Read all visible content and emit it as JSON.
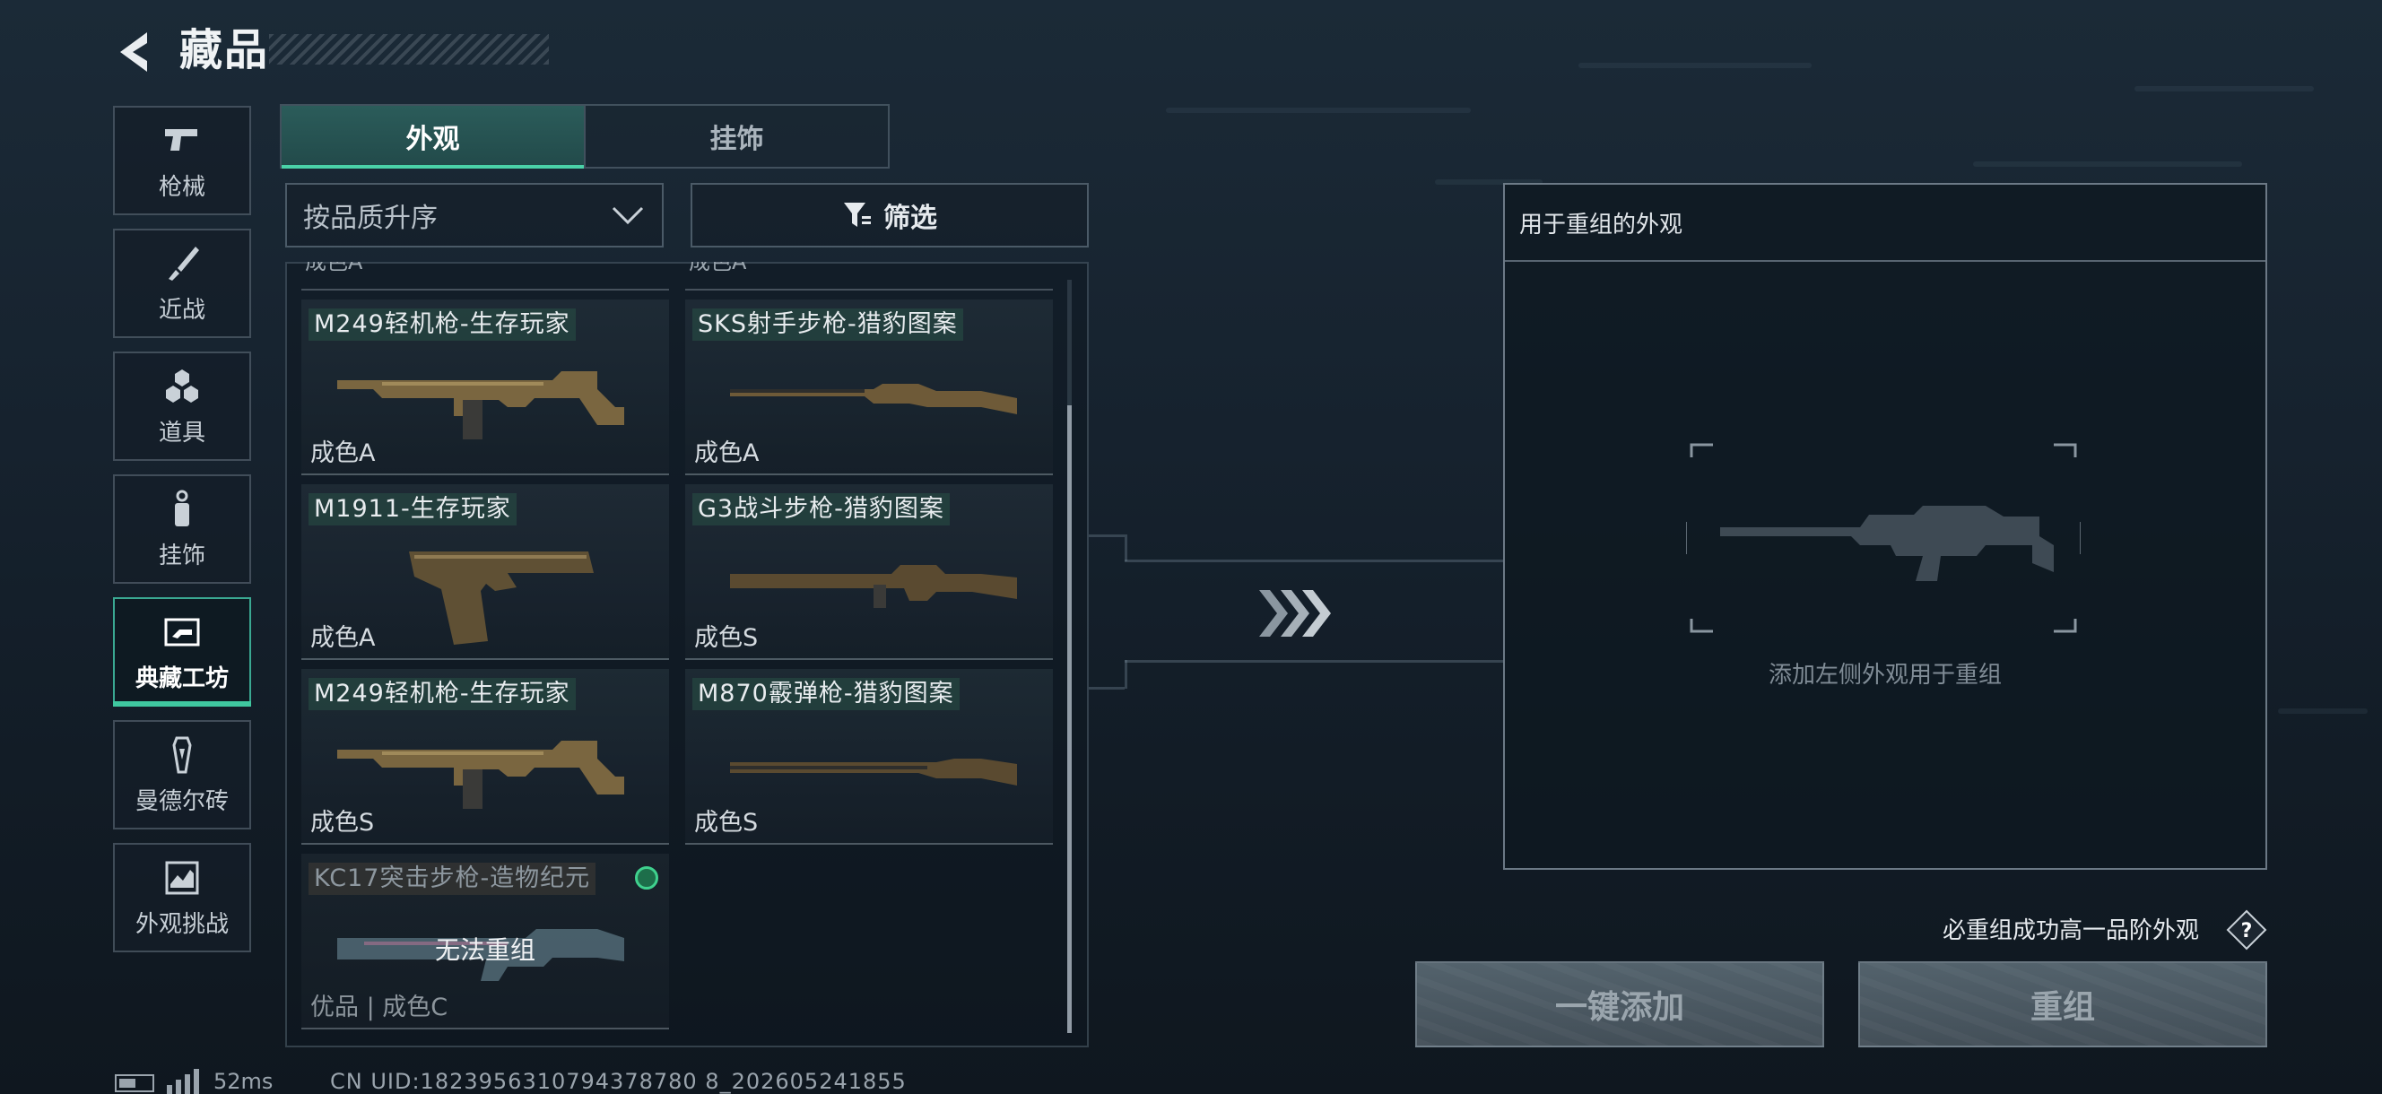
{
  "header": {
    "title": "藏品"
  },
  "sidebar": {
    "items": [
      {
        "label": "枪械",
        "icon": "pistol-icon"
      },
      {
        "label": "近战",
        "icon": "knife-icon"
      },
      {
        "label": "道具",
        "icon": "hexagon-cluster-icon"
      },
      {
        "label": "挂饰",
        "icon": "charm-icon"
      },
      {
        "label": "典藏工坊",
        "icon": "workshop-icon",
        "active": true
      },
      {
        "label": "曼德尔砖",
        "icon": "mandel-brick-icon"
      },
      {
        "label": "外观挑战",
        "icon": "challenge-icon"
      }
    ]
  },
  "tabs": [
    {
      "label": "外观",
      "active": true
    },
    {
      "label": "挂饰",
      "active": false
    }
  ],
  "sort": {
    "label": "按品质升序"
  },
  "filter": {
    "label": "筛选"
  },
  "items": [
    {
      "name": "M249轻机枪-生存玩家",
      "grade": "成色A",
      "gun": "lmg"
    },
    {
      "name": "SKS射手步枪-猎豹图案",
      "grade": "成色A",
      "gun": "rifle"
    },
    {
      "name": "M1911-生存玩家",
      "grade": "成色A",
      "gun": "pistol"
    },
    {
      "name": "G3战斗步枪-猎豹图案",
      "grade": "成色S",
      "gun": "rifle"
    },
    {
      "name": "M249轻机枪-生存玩家",
      "grade": "成色S",
      "gun": "lmg"
    },
    {
      "name": "M870霰弹枪-猎豹图案",
      "grade": "成色S",
      "gun": "shotgun"
    },
    {
      "name": "KC17突击步枪-造物纪元",
      "grade": "优品 | 成色C",
      "gun": "assault",
      "disabled": true,
      "overlay": "无法重组"
    }
  ],
  "partial_row": [
    "成色A",
    "成色A"
  ],
  "recast_panel": {
    "title": "用于重组的外观",
    "hint": "添加左侧外观用于重组"
  },
  "guarantee": {
    "text": "必重组成功高一品阶外观",
    "help": "?"
  },
  "buttons": {
    "add_all": "一键添加",
    "recast": "重组"
  },
  "status": {
    "ping": "52ms",
    "uid": "CN UID:1823956310794378780 8_202605241855"
  },
  "colors": {
    "accent": "#3fc79f",
    "active_tab": "#2b5c5a",
    "status_dot": "#3fd18e"
  }
}
